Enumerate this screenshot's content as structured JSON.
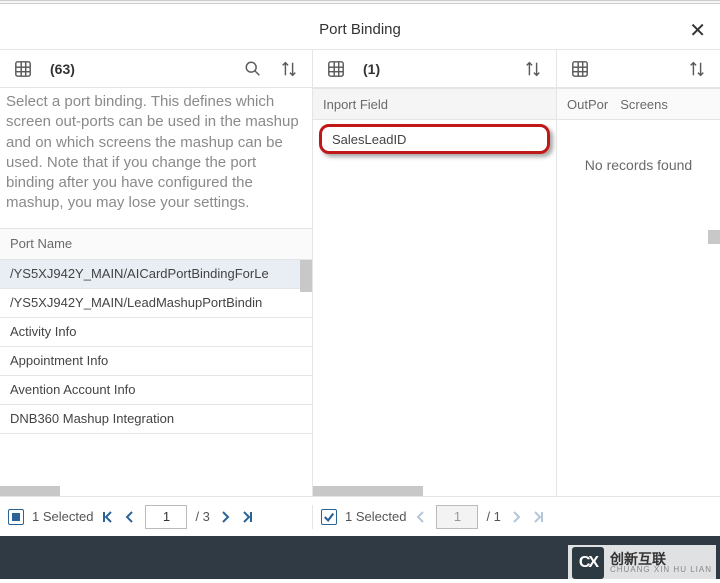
{
  "title": "Port Binding",
  "toolbar": {
    "left_count": "(63)",
    "mid_count": "(1)"
  },
  "description": "Select a port binding. This defines which screen out-ports can be used in the mashup and on which screens the mashup can be used. Note that if you change the port binding after you have configured the mashup, you may lose your settings.",
  "col1": {
    "header": "Port Name",
    "rows": [
      "/YS5XJ942Y_MAIN/AICardPortBindingForLe",
      "/YS5XJ942Y_MAIN/LeadMashupPortBindin",
      "Activity Info",
      "Appointment Info",
      "Avention Account Info",
      "DNB360 Mashup Integration"
    ]
  },
  "col2": {
    "header": "Inport Field",
    "rows": [
      "SalesLeadID"
    ]
  },
  "col3": {
    "header1": "OutPor",
    "header2": "Screens",
    "no_records": "No records found"
  },
  "pagerA": {
    "selected": "1 Selected",
    "page": "1",
    "total": "/ 3"
  },
  "pagerB": {
    "selected": "1 Selected",
    "page": "1",
    "total": "/ 1"
  },
  "brand": {
    "cn": "创新互联",
    "en": "CHUANG XIN HU LIAN"
  }
}
